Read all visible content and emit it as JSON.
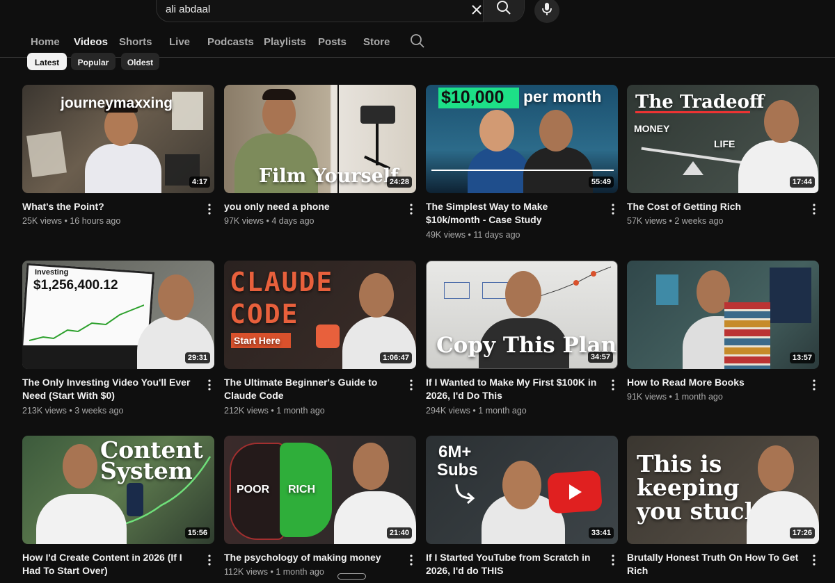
{
  "search": {
    "query": "ali abdaal"
  },
  "tabs": [
    "Home",
    "Videos",
    "Shorts",
    "Live",
    "Podcasts",
    "Playlists",
    "Posts",
    "Store"
  ],
  "chips": [
    "Latest",
    "Popular",
    "Oldest"
  ],
  "videos": [
    {
      "title": "What's the Point?",
      "views": "25K views",
      "age": "16 hours ago",
      "duration": "4:17",
      "thumb_text": "journeymaxxing"
    },
    {
      "title": "you only need a phone",
      "views": "97K views",
      "age": "4 days ago",
      "duration": "24:28",
      "thumb_text": "Film Yourself"
    },
    {
      "title": "The Simplest Way to Make $10k/month - Case Study",
      "views": "49K views",
      "age": "11 days ago",
      "duration": "55:49",
      "thumb_text": "$10,000",
      "thumb_text2": "per month"
    },
    {
      "title": "The Cost of Getting Rich",
      "views": "57K views",
      "age": "2 weeks ago",
      "duration": "17:44",
      "thumb_text": "The Tradeoff",
      "thumb_text2": "MONEY",
      "thumb_text3": "LIFE"
    },
    {
      "title": "The Only Investing Video You'll Ever Need (Start With $0)",
      "views": "213K views",
      "age": "3 weeks ago",
      "duration": "29:31",
      "thumb_text": "$1,256,400.12",
      "thumb_text2": "Investing"
    },
    {
      "title": "The Ultimate Beginner's Guide to Claude Code",
      "views": "212K views",
      "age": "1 month ago",
      "duration": "1:06:47",
      "thumb_text": "CLAUDE",
      "thumb_text2": "CODE",
      "thumb_text3": "Start Here"
    },
    {
      "title": "If I Wanted to Make My First $100K in 2026, I'd Do This",
      "views": "294K views",
      "age": "1 month ago",
      "duration": "34:57",
      "thumb_text": "Copy This Plan"
    },
    {
      "title": "How to Read More Books",
      "views": "91K views",
      "age": "1 month ago",
      "duration": "13:57"
    },
    {
      "title": "How I'd Create Content in 2026 (If I Had To Start Over)",
      "views": "",
      "age": "",
      "duration": "15:56",
      "thumb_text": "Content",
      "thumb_text2": "System"
    },
    {
      "title": "The psychology of making money",
      "views": "112K views",
      "age": "1 month ago",
      "duration": "21:40",
      "thumb_text": "POOR",
      "thumb_text2": "RICH"
    },
    {
      "title": "If I Started YouTube from Scratch in 2026, I'd do THIS",
      "views": "",
      "age": "",
      "duration": "33:41",
      "thumb_text": "6M+",
      "thumb_text2": "Subs"
    },
    {
      "title": "Brutally Honest Truth On How To Get Rich",
      "views": "",
      "age": "",
      "duration": "17:26",
      "thumb_text": "This is",
      "thumb_text2": "keeping",
      "thumb_text3": "you stuck"
    }
  ],
  "colors": {
    "background": "#0f0f0f",
    "text": "#f1f1f1",
    "secondary_text": "#aaaaaa",
    "chip": "#272727"
  }
}
